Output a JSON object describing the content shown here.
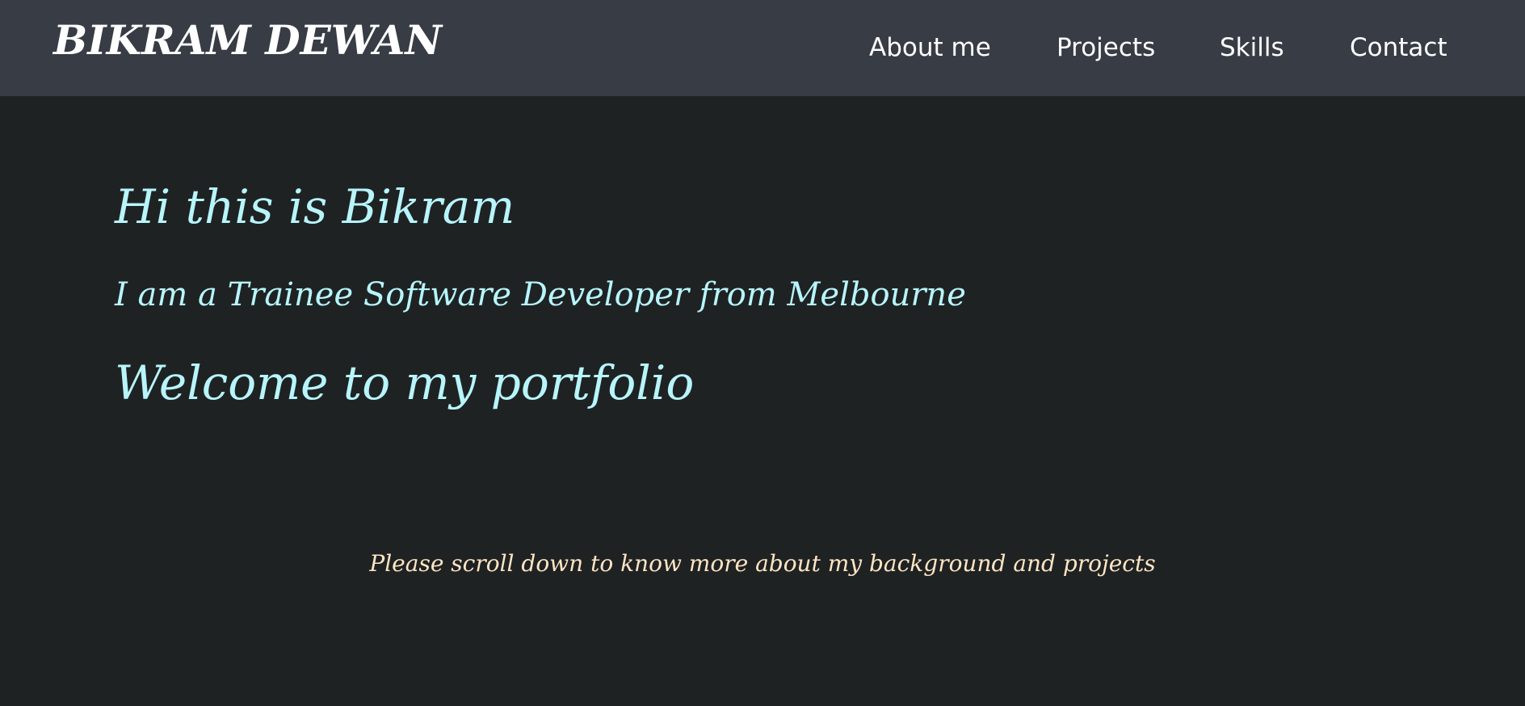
{
  "header": {
    "brand": "BIKRAM DEWAN",
    "nav": [
      {
        "label": "About me"
      },
      {
        "label": "Projects"
      },
      {
        "label": "Skills"
      },
      {
        "label": "Contact"
      }
    ]
  },
  "hero": {
    "greeting": "Hi this is Bikram",
    "role": "I am a Trainee Software Developer from Melbourne",
    "welcome": "Welcome to my portfolio"
  },
  "footer_hint": "Please scroll down to know more about my background and projects",
  "colors": {
    "navbar_bg": "#373c45",
    "page_bg": "#1f2223",
    "hero_text": "#b7f5fb",
    "hint_text": "#fde5c4",
    "nav_text": "#ffffff"
  }
}
